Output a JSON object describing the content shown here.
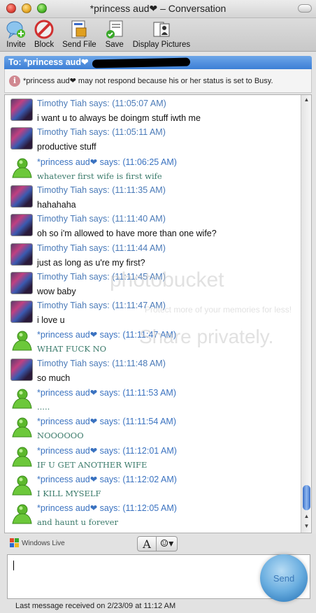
{
  "window": {
    "title": "*princess aud❤ – Conversation"
  },
  "toolbar": {
    "buttons": [
      {
        "label": "Invite",
        "icon": "invite-icon"
      },
      {
        "label": "Block",
        "icon": "block-icon"
      },
      {
        "label": "Send File",
        "icon": "send-file-icon"
      },
      {
        "label": "Save",
        "icon": "save-icon"
      },
      {
        "label": "Display Pictures",
        "icon": "display-pictures-icon"
      }
    ]
  },
  "to_header": "To: *princess aud❤",
  "notice": "*princess aud❤ may not respond because his or her status is set to Busy.",
  "messages": [
    {
      "sender": "Timothy Tiah says: (11:05:07 AM)",
      "text": "i want u to always be doingm stuff iwth me",
      "who": "tim"
    },
    {
      "sender": "Timothy Tiah says: (11:05:11 AM)",
      "text": "productive stuff",
      "who": "tim"
    },
    {
      "sender": "*princess aud❤ says: (11:06:25 AM)",
      "text": "whatever first wife is first wife",
      "who": "aud"
    },
    {
      "sender": "Timothy Tiah says: (11:11:35 AM)",
      "text": "hahahaha",
      "who": "tim"
    },
    {
      "sender": "Timothy Tiah says: (11:11:40 AM)",
      "text": "oh so i'm allowed to have more than one wife?",
      "who": "tim"
    },
    {
      "sender": "Timothy Tiah says: (11:11:44 AM)",
      "text": "just as long as u're my first?",
      "who": "tim"
    },
    {
      "sender": "Timothy Tiah says: (11:11:45 AM)",
      "text": "wow baby",
      "who": "tim"
    },
    {
      "sender": "Timothy Tiah says: (11:11:47 AM)",
      "text": "i love u",
      "who": "tim"
    },
    {
      "sender": "*princess aud❤ says: (11:11:47 AM)",
      "text": "WHAT FUCK NO",
      "who": "aud"
    },
    {
      "sender": "Timothy Tiah says: (11:11:48 AM)",
      "text": "so much",
      "who": "tim"
    },
    {
      "sender": "*princess aud❤ says: (11:11:53 AM)",
      "text": ".....",
      "who": "aud"
    },
    {
      "sender": "*princess aud❤ says: (11:11:54 AM)",
      "text": "NOOOOOO",
      "who": "aud"
    },
    {
      "sender": "*princess aud❤ says: (11:12:01 AM)",
      "text": "IF U GET ANOTHER WIFE",
      "who": "aud"
    },
    {
      "sender": "*princess aud❤ says: (11:12:02 AM)",
      "text": "I KILL MYSELF",
      "who": "aud"
    },
    {
      "sender": "*princess aud❤ says: (11:12:05 AM)",
      "text": "and haunt u forever",
      "who": "aud"
    }
  ],
  "watermarks": [
    "photobucket",
    "Protect more of your memories for less!",
    "Share privately."
  ],
  "bottom": {
    "windows_live": "Windows Live",
    "format_button": "A",
    "emoticon_button": "☺▾",
    "send_label": "Send",
    "status": "Last message received on 2/23/09 at 11:12 AM"
  }
}
